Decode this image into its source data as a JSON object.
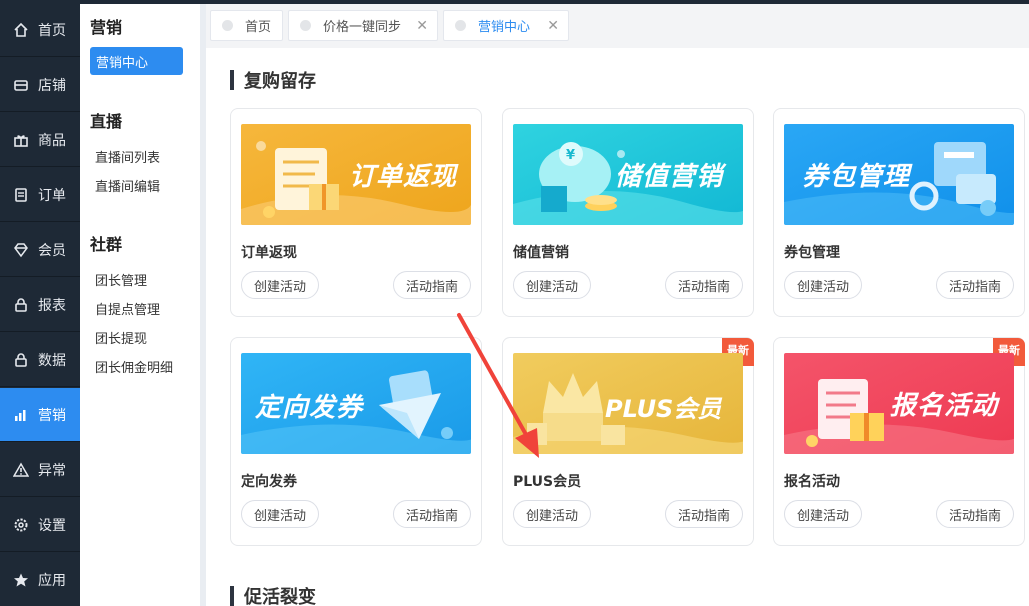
{
  "nav": {
    "items": [
      {
        "label": "首页",
        "icon": "home-icon"
      },
      {
        "label": "店铺",
        "icon": "store-icon"
      },
      {
        "label": "商品",
        "icon": "gift-icon"
      },
      {
        "label": "订单",
        "icon": "order-icon"
      },
      {
        "label": "会员",
        "icon": "diamond-icon"
      },
      {
        "label": "报表",
        "icon": "lock-icon"
      },
      {
        "label": "数据",
        "icon": "lock-icon"
      },
      {
        "label": "营销",
        "icon": "bar-chart-icon",
        "active": true
      },
      {
        "label": "异常",
        "icon": "warning-icon"
      },
      {
        "label": "设置",
        "icon": "gear-icon"
      },
      {
        "label": "应用",
        "icon": "star-icon"
      }
    ]
  },
  "subnav": {
    "marketing_title": "营销",
    "marketing_center": "营销中心",
    "live_title": "直播",
    "live_items": [
      "直播间列表",
      "直播间编辑"
    ],
    "community_title": "社群",
    "community_items": [
      "团长管理",
      "自提点管理",
      "团长提现",
      "团长佣金明细"
    ]
  },
  "tabs": [
    {
      "label": "首页",
      "closable": false
    },
    {
      "label": "价格一键同步",
      "closable": true
    },
    {
      "label": "营销中心",
      "closable": true,
      "active": true
    }
  ],
  "sections": [
    {
      "title": "复购留存"
    },
    {
      "title": "促活裂变"
    }
  ],
  "cards": [
    {
      "banner_text": "订单返现",
      "title": "订单返现",
      "create": "创建活动",
      "guide": "活动指南",
      "badge": ""
    },
    {
      "banner_text": "储值营销",
      "title": "储值营销",
      "create": "创建活动",
      "guide": "活动指南",
      "badge": ""
    },
    {
      "banner_text": "券包管理",
      "title": "券包管理",
      "create": "创建活动",
      "guide": "活动指南",
      "badge": ""
    },
    {
      "banner_text": "定向发券",
      "title": "定向发券",
      "create": "创建活动",
      "guide": "活动指南",
      "badge": ""
    },
    {
      "banner_text": "PLUS会员",
      "title": "PLUS会员",
      "create": "创建活动",
      "guide": "活动指南",
      "badge": "最新"
    },
    {
      "banner_text": "报名活动",
      "title": "报名活动",
      "create": "创建活动",
      "guide": "活动指南",
      "badge": "最新"
    }
  ],
  "colors": {
    "nav_bg": "#1e2936",
    "accent": "#2d8cf0",
    "badge": "#f25a3b",
    "arrow": "#f0433a"
  }
}
